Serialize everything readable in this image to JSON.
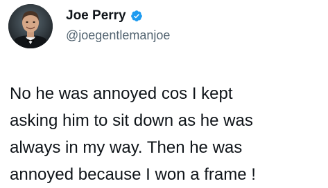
{
  "author": {
    "display_name": "Joe Perry",
    "handle": "@joegentlemanjoe",
    "verified_icon": "verified-badge-icon",
    "verified_color": "#1d9bf0"
  },
  "tweet": {
    "lines": [
      "No he was annoyed cos I kept",
      "asking him to sit down as he was",
      "always in my way. Then he was",
      "annoyed because I won a frame !"
    ]
  }
}
